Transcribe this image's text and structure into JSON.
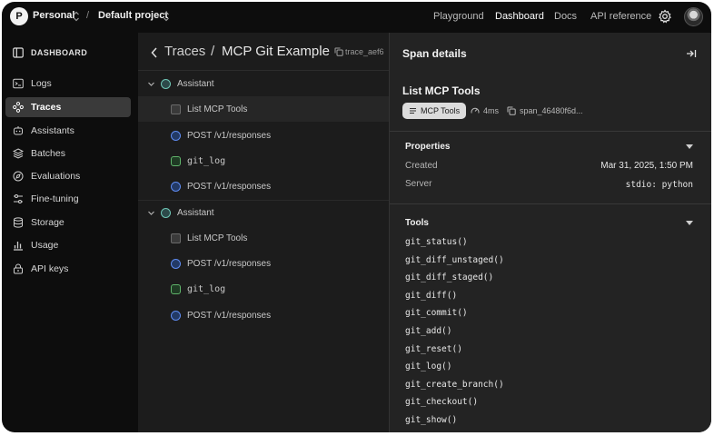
{
  "topbar": {
    "org_initial": "P",
    "org": "Personal",
    "separator": "/",
    "project": "Default project",
    "nav": [
      "Playground",
      "Dashboard",
      "Docs",
      "API reference"
    ],
    "active_nav": "Dashboard"
  },
  "sidebar": {
    "header": "DASHBOARD",
    "items": [
      {
        "label": "Logs",
        "icon": "terminal-icon"
      },
      {
        "label": "Traces",
        "icon": "traces-icon",
        "active": true
      },
      {
        "label": "Assistants",
        "icon": "assistant-icon"
      },
      {
        "label": "Batches",
        "icon": "batches-icon"
      },
      {
        "label": "Evaluations",
        "icon": "evaluations-icon"
      },
      {
        "label": "Fine-tuning",
        "icon": "fine-tuning-icon"
      },
      {
        "label": "Storage",
        "icon": "storage-icon"
      },
      {
        "label": "Usage",
        "icon": "usage-icon"
      },
      {
        "label": "API keys",
        "icon": "key-icon"
      }
    ]
  },
  "traces": {
    "breadcrumb_root": "Traces",
    "breadcrumb_sep": "/",
    "title": "MCP Git Example",
    "trace_id": "trace_aef6",
    "rows": [
      {
        "label": "Assistant",
        "kind": "asst"
      },
      {
        "label": "List MCP Tools",
        "kind": "tool",
        "selected": true
      },
      {
        "label": "POST /v1/responses",
        "kind": "post"
      },
      {
        "label": "git_log",
        "kind": "fn"
      },
      {
        "label": "POST /v1/responses",
        "kind": "post"
      },
      {
        "label": "Assistant",
        "kind": "asst"
      },
      {
        "label": "List MCP Tools",
        "kind": "tool"
      },
      {
        "label": "POST /v1/responses",
        "kind": "post"
      },
      {
        "label": "git_log",
        "kind": "fn"
      },
      {
        "label": "POST /v1/responses",
        "kind": "post"
      }
    ]
  },
  "details": {
    "title": "Span details",
    "span_name": "List MCP Tools",
    "pill": "MCP Tools",
    "duration": "4ms",
    "span_id": "span_46480f6d...",
    "properties_title": "Properties",
    "created_label": "Created",
    "created_value": "Mar 31, 2025, 1:50 PM",
    "server_label": "Server",
    "server_value": "stdio: python",
    "tools_title": "Tools",
    "tools": [
      "git_status()",
      "git_diff_unstaged()",
      "git_diff_staged()",
      "git_diff()",
      "git_commit()",
      "git_add()",
      "git_reset()",
      "git_log()",
      "git_create_branch()",
      "git_checkout()",
      "git_show()"
    ]
  }
}
